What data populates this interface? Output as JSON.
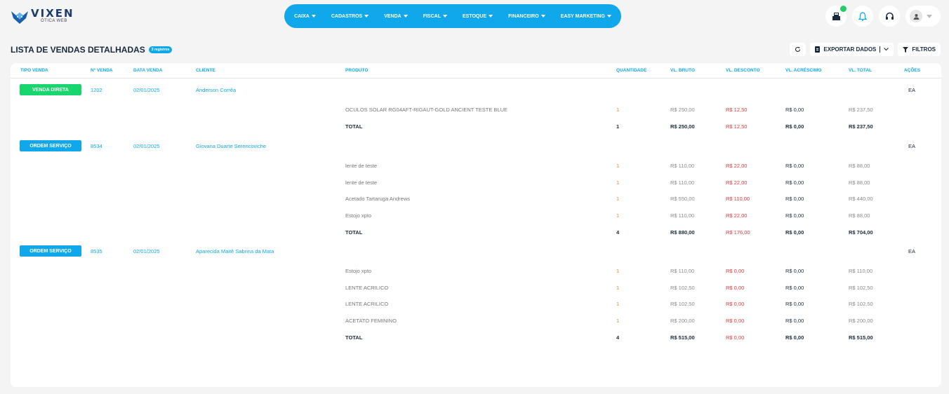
{
  "brand": {
    "name": "VIXEN",
    "sub": "ÓTICA WEB"
  },
  "nav": [
    "CAIXA",
    "CADASTROS",
    "VENDA",
    "FISCAL",
    "ESTOQUE",
    "FINANCEIRO",
    "EASY MARKETING"
  ],
  "page": {
    "title": "LISTA DE VENDAS DETALHADAS",
    "badge": "3 registros",
    "export": "EXPORTAR DADOS",
    "filters": "FILTROS"
  },
  "columns": [
    "TIPO VENDA",
    "Nº VENDA",
    "DATA VENDA",
    "CLIENTE",
    "PRODUTO",
    "QUANTIDADE",
    "VL. BRUTO",
    "VL. DESCONTO",
    "VL. ACRÉSCIMO",
    "VL. TOTAL",
    "AÇÕES"
  ],
  "sales": [
    {
      "tipo": "VENDA DIRETA",
      "color": "#18d66e",
      "numero": "1202",
      "data": "02/01/2025",
      "cliente": "Anderson Corrêa",
      "acao": "EA",
      "items": [
        {
          "produto": "OCULOS SOLAR RG04AFT-RIGAUT-GOLD ANCIENT TESTE BLUE",
          "qtd": "1",
          "bruto": "R$ 250,00",
          "desconto": "R$ 12,50",
          "acrescimo": "R$ 0,00",
          "total": "R$ 237,50"
        }
      ],
      "totals": {
        "label": "TOTAL",
        "qtd": "1",
        "bruto": "R$ 250,00",
        "desconto": "R$ 12,50",
        "acrescimo": "R$ 0,00",
        "total": "R$ 237,50"
      }
    },
    {
      "tipo": "ORDEM SERVIÇO",
      "color": "#10a8ea",
      "numero": "8534",
      "data": "02/01/2025",
      "cliente": "Giovana Duarte Serencoviche",
      "acao": "EA",
      "items": [
        {
          "produto": "lente de teste",
          "qtd": "1",
          "bruto": "R$ 110,00",
          "desconto": "R$ 22,00",
          "acrescimo": "R$ 0,00",
          "total": "R$ 88,00"
        },
        {
          "produto": "lente de teste",
          "qtd": "1",
          "bruto": "R$ 110,00",
          "desconto": "R$ 22,00",
          "acrescimo": "R$ 0,00",
          "total": "R$ 88,00"
        },
        {
          "produto": "Acetado Tartaruga Andrews",
          "qtd": "1",
          "bruto": "R$ 550,00",
          "desconto": "R$ 110,00",
          "acrescimo": "R$ 0,00",
          "total": "R$ 440,00"
        },
        {
          "produto": "Estojo xpto",
          "qtd": "1",
          "bruto": "R$ 110,00",
          "desconto": "R$ 22,00",
          "acrescimo": "R$ 0,00",
          "total": "R$ 88,00"
        }
      ],
      "totals": {
        "label": "TOTAL",
        "qtd": "4",
        "bruto": "R$ 880,00",
        "desconto": "R$ 176,00",
        "acrescimo": "R$ 0,00",
        "total": "R$ 704,00"
      }
    },
    {
      "tipo": "ORDEM SERVIÇO",
      "color": "#10a8ea",
      "numero": "8535",
      "data": "02/01/2025",
      "cliente": "Aparecida Maitê Sabrina da Mata",
      "acao": "EA",
      "items": [
        {
          "produto": "Estojo xpto",
          "qtd": "1",
          "bruto": "R$ 110,00",
          "desconto": "R$ 0,00",
          "acrescimo": "R$ 0,00",
          "total": "R$ 110,00"
        },
        {
          "produto": "LENTE ACRILICO",
          "qtd": "1",
          "bruto": "R$ 102,50",
          "desconto": "R$ 0,00",
          "acrescimo": "R$ 0,00",
          "total": "R$ 102,50"
        },
        {
          "produto": "LENTE ACRILICO",
          "qtd": "1",
          "bruto": "R$ 102,50",
          "desconto": "R$ 0,00",
          "acrescimo": "R$ 0,00",
          "total": "R$ 102,50"
        },
        {
          "produto": "ACETATO FEMININO",
          "qtd": "1",
          "bruto": "R$ 200,00",
          "desconto": "R$ 0,00",
          "acrescimo": "R$ 0,00",
          "total": "R$ 200,00"
        }
      ],
      "totals": {
        "label": "TOTAL",
        "qtd": "4",
        "bruto": "R$ 515,00",
        "desconto": "R$ 0,00",
        "acrescimo": "R$ 0,00",
        "total": "R$ 515,00"
      }
    }
  ]
}
